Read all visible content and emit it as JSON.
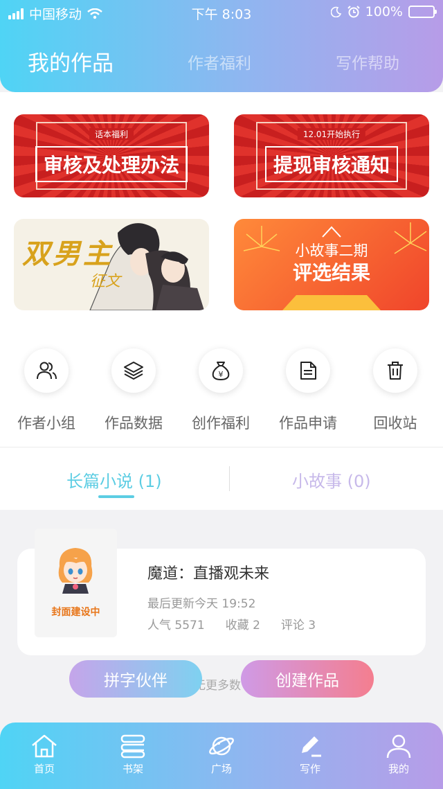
{
  "status_bar": {
    "carrier": "中国移动",
    "time": "下午 8:03",
    "battery": "100%"
  },
  "header": {
    "tabs": [
      {
        "label": "我的作品"
      },
      {
        "label": "作者福利"
      },
      {
        "label": "写作帮助"
      }
    ]
  },
  "banners": [
    {
      "small": "话本福利",
      "big": "审核及处理办法"
    },
    {
      "small": "12.01开始执行",
      "big": "提现审核通知"
    },
    {
      "title": "双男主",
      "sub": "征文"
    },
    {
      "line1": "小故事二期",
      "line2": "评选结果"
    }
  ],
  "quick_menu": [
    {
      "label": "作者小组",
      "icon": "group-icon"
    },
    {
      "label": "作品数据",
      "icon": "layers-icon"
    },
    {
      "label": "创作福利",
      "icon": "money-bag-icon"
    },
    {
      "label": "作品申请",
      "icon": "document-icon"
    },
    {
      "label": "回收站",
      "icon": "trash-icon"
    }
  ],
  "sub_tabs": [
    {
      "label": "长篇小说 (1)"
    },
    {
      "label": "小故事 (0)"
    }
  ],
  "work": {
    "cover_label": "封面建设中",
    "title": "魔道：直播观未来",
    "updated": "最后更新今天 19:52",
    "popularity": "人气 5571",
    "favorites": "收藏 2",
    "comments": "评论 3"
  },
  "more_hint": "无更多数",
  "actions": {
    "partner": "拼字伙伴",
    "create": "创建作品"
  },
  "tab_bar": [
    {
      "label": "首页",
      "icon": "home-icon"
    },
    {
      "label": "书架",
      "icon": "bookshelf-icon"
    },
    {
      "label": "广场",
      "icon": "planet-icon"
    },
    {
      "label": "写作",
      "icon": "pen-icon"
    },
    {
      "label": "我的",
      "icon": "user-icon"
    }
  ],
  "colors": {
    "accent": "#5ccde3",
    "inactive_tab": "#c7b9ea",
    "red": "#d42a25"
  }
}
